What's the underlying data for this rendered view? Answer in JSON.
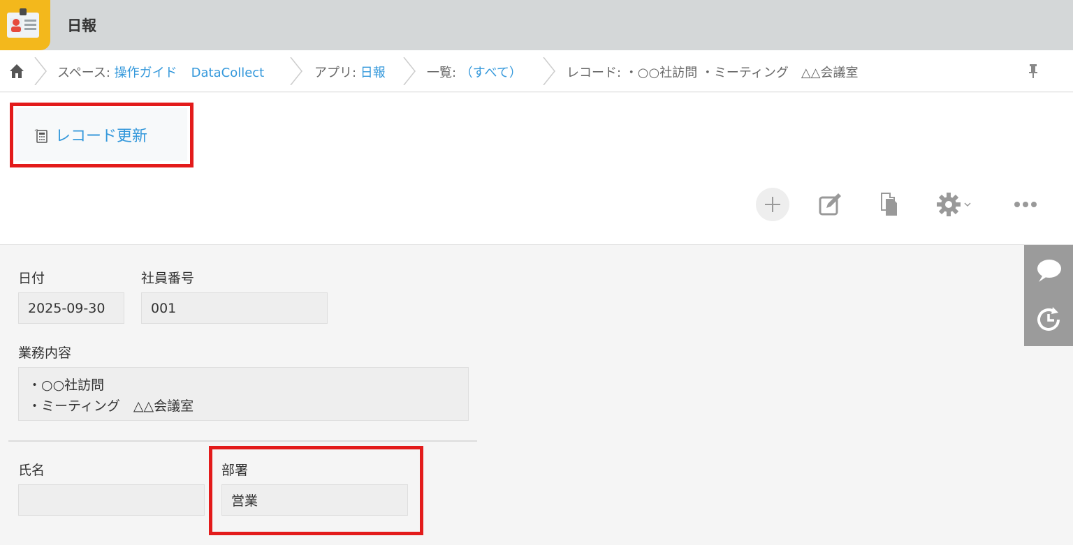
{
  "header": {
    "title": "日報",
    "icon": "app-id-card-icon"
  },
  "breadcrumb": {
    "space_label": "スペース: ",
    "space_link": "操作ガイド",
    "space_sub": "DataCollect",
    "app_label": "アプリ: ",
    "app_link": "日報",
    "view_label": "一覧: ",
    "view_link": "（すべて）",
    "record_label": "レコード: ・○○社訪問 ・ミーティング　△△会議室"
  },
  "plugin": {
    "label": "レコード更新",
    "icon": "calculator-icon"
  },
  "toolbar": [
    "add-icon",
    "edit-icon",
    "copy-icon",
    "gear-icon",
    "more-icon"
  ],
  "record": {
    "date": {
      "label": "日付",
      "value": "2025-09-30"
    },
    "employee_no": {
      "label": "社員番号",
      "value": "001"
    },
    "work": {
      "label": "業務内容",
      "line1": "・○○社訪問",
      "line2": "・ミーティング　△△会議室"
    },
    "name": {
      "label": "氏名",
      "value": ""
    },
    "dept": {
      "label": "部署",
      "value": "営業"
    }
  },
  "colors": {
    "accent": "#3498db",
    "highlight": "#e31b1b",
    "app_icon": "#f3b81c"
  }
}
